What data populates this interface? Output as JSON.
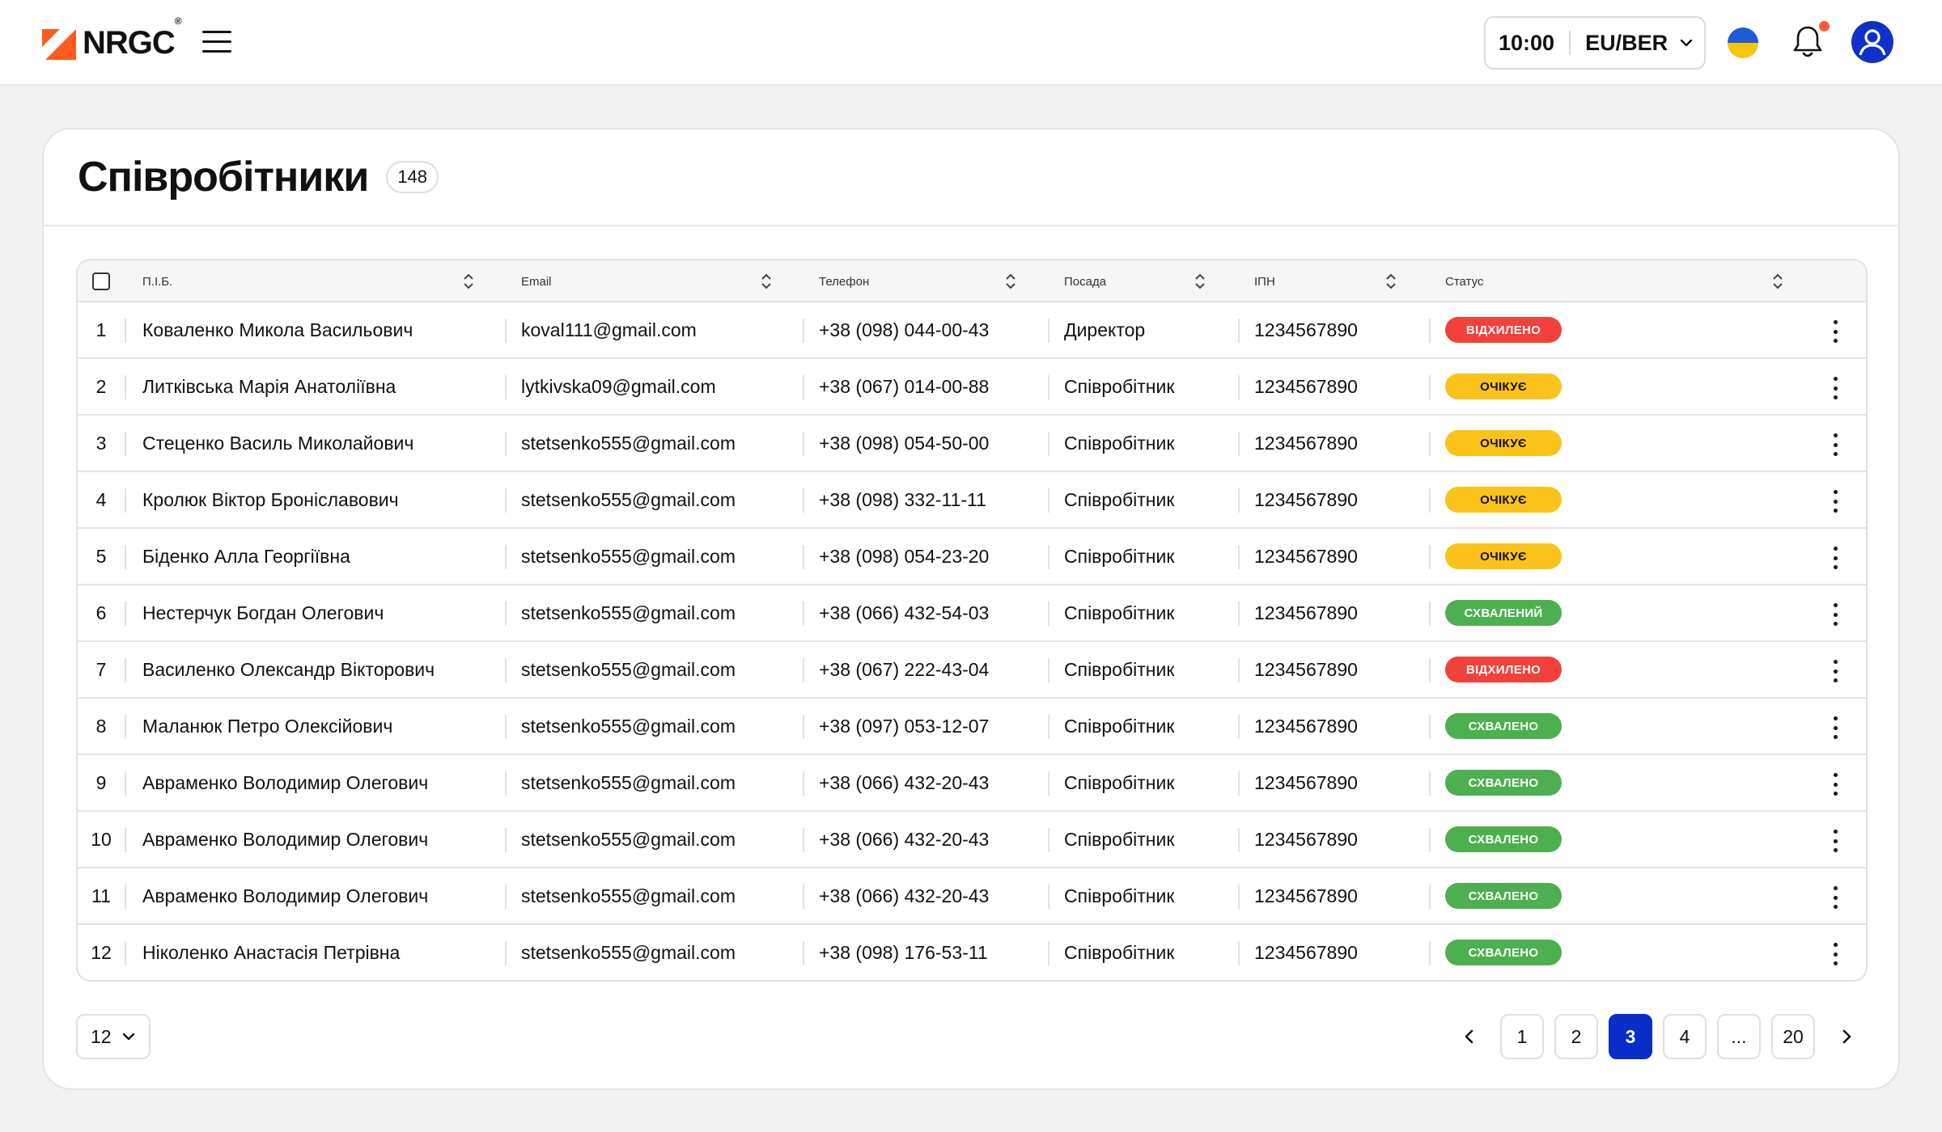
{
  "header": {
    "logo_text": "NRGC",
    "logo_reg": "®",
    "time": "10:00",
    "timezone": "EU/BER",
    "notification_dot_color": "#ff5a36"
  },
  "page": {
    "title": "Співробітники",
    "count": "148"
  },
  "table": {
    "columns": {
      "name": "П.І.Б.",
      "email": "Email",
      "phone": "Телефон",
      "position": "Посада",
      "ipn": "ІПН",
      "status": "Статус"
    },
    "rows": [
      {
        "num": "1",
        "name": "Коваленко Микола Васильович",
        "email": "koval111@gmail.com",
        "phone": "+38 (098) 044-00-43",
        "position": "Директор",
        "ipn": "1234567890",
        "status": "ВІДХИЛЕНО",
        "status_type": "rejected"
      },
      {
        "num": "2",
        "name": "Литківська Марія Анатоліївна",
        "email": "lytkivska09@gmail.com",
        "phone": "+38 (067) 014-00-88",
        "position": "Співробітник",
        "ipn": "1234567890",
        "status": "ОЧІКУЄ",
        "status_type": "pending"
      },
      {
        "num": "3",
        "name": "Стеценко Василь Миколайович",
        "email": "stetsenko555@gmail.com",
        "phone": "+38 (098) 054-50-00",
        "position": "Співробітник",
        "ipn": "1234567890",
        "status": "ОЧІКУЄ",
        "status_type": "pending"
      },
      {
        "num": "4",
        "name": "Кролюк Віктор Броніславович",
        "email": "stetsenko555@gmail.com",
        "phone": "+38 (098) 332-11-11",
        "position": "Співробітник",
        "ipn": "1234567890",
        "status": "ОЧІКУЄ",
        "status_type": "pending"
      },
      {
        "num": "5",
        "name": "Біденко Алла Георгіївна",
        "email": "stetsenko555@gmail.com",
        "phone": "+38 (098) 054-23-20",
        "position": "Співробітник",
        "ipn": "1234567890",
        "status": "ОЧІКУЄ",
        "status_type": "pending"
      },
      {
        "num": "6",
        "name": "Нестерчук Богдан Олегович",
        "email": "stetsenko555@gmail.com",
        "phone": "+38 (066) 432-54-03",
        "position": "Співробітник",
        "ipn": "1234567890",
        "status": "СХВАЛЕНИЙ",
        "status_type": "approved"
      },
      {
        "num": "7",
        "name": "Василенко Олександр Вікторович",
        "email": "stetsenko555@gmail.com",
        "phone": "+38 (067) 222-43-04",
        "position": "Співробітник",
        "ipn": "1234567890",
        "status": "ВІДХИЛЕНО",
        "status_type": "rejected"
      },
      {
        "num": "8",
        "name": "Маланюк Петро Олексійович",
        "email": "stetsenko555@gmail.com",
        "phone": "+38 (097) 053-12-07",
        "position": "Співробітник",
        "ipn": "1234567890",
        "status": "СХВАЛЕНО",
        "status_type": "approved"
      },
      {
        "num": "9",
        "name": "Авраменко Володимир Олегович",
        "email": "stetsenko555@gmail.com",
        "phone": "+38 (066) 432-20-43",
        "position": "Співробітник",
        "ipn": "1234567890",
        "status": "СХВАЛЕНО",
        "status_type": "approved"
      },
      {
        "num": "10",
        "name": "Авраменко Володимир Олегович",
        "email": "stetsenko555@gmail.com",
        "phone": "+38 (066) 432-20-43",
        "position": "Співробітник",
        "ipn": "1234567890",
        "status": "СХВАЛЕНО",
        "status_type": "approved"
      },
      {
        "num": "11",
        "name": "Авраменко Володимир Олегович",
        "email": "stetsenko555@gmail.com",
        "phone": "+38 (066) 432-20-43",
        "position": "Співробітник",
        "ipn": "1234567890",
        "status": "СХВАЛЕНО",
        "status_type": "approved"
      },
      {
        "num": "12",
        "name": "Ніколенко Анастасія Петрівна",
        "email": "stetsenko555@gmail.com",
        "phone": "+38 (098) 176-53-11",
        "position": "Співробітник",
        "ipn": "1234567890",
        "status": "СХВАЛЕНО",
        "status_type": "approved"
      }
    ]
  },
  "footer": {
    "per_page": "12",
    "pages": [
      "1",
      "2",
      "3",
      "4",
      "...",
      "20"
    ],
    "current_page": "3"
  },
  "colors": {
    "accent": "#0a2cc8",
    "logo_orange": "#ff5a1f",
    "rejected": "#f2403a",
    "pending": "#fbc21a",
    "approved": "#4caf50"
  }
}
